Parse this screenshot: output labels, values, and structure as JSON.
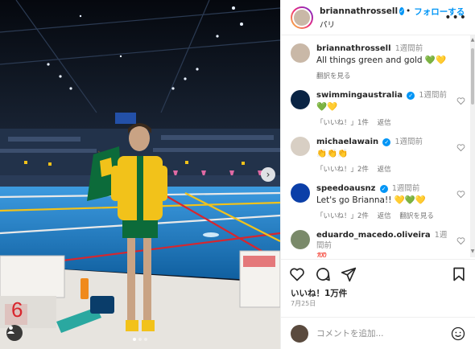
{
  "post": {
    "author": "briannathrossell",
    "follow_label": "フォローする",
    "location": "パリ",
    "more_label": "•••",
    "likes": "いいね！1万件",
    "date": "7月25日"
  },
  "caption": {
    "user": "briannathrossell",
    "time": "1週間前",
    "text": "All things green and gold 💚💛",
    "translate": "翻訳を見る"
  },
  "comments": [
    {
      "user": "swimmingaustralia",
      "verified": true,
      "time": "1週間前",
      "text": "💚💛",
      "likes": "「いいね！」1件",
      "reply": "返信",
      "translate": "",
      "avatar_color": "#0a2444"
    },
    {
      "user": "michaelawain",
      "verified": true,
      "time": "1週間前",
      "text": "👏👏👏",
      "likes": "「いいね！」2件",
      "reply": "返信",
      "translate": "",
      "avatar_color": "#d8cfc4"
    },
    {
      "user": "speedoausnz",
      "verified": true,
      "time": "1週間前",
      "text": "Let's go Brianna!! 💛💚💛",
      "likes": "「いいね！」2件",
      "reply": "返信",
      "translate": "翻訳を見る",
      "avatar_color": "#0b3fa8"
    },
    {
      "user": "eduardo_macedo.oliveira",
      "verified": false,
      "time": "1週間前",
      "text": "💯",
      "likes": "",
      "reply": "",
      "translate": "",
      "avatar_color": "#7a8a6a"
    }
  ],
  "add_comment": {
    "placeholder": "コメントを追加..."
  },
  "photo": {
    "lane_number": "6"
  },
  "icons": {
    "like": "heart-icon",
    "comment": "comment-icon",
    "share": "share-icon",
    "save": "bookmark-icon",
    "emoji": "emoji-icon",
    "next": "chevron-right-icon",
    "tag": "user-tag-icon"
  },
  "colors": {
    "accent": "#0095f6",
    "pool": "#1c7fc4",
    "lane_red": "#d8262d",
    "cap_yellow": "#f2c21a",
    "green": "#0c6b3a"
  }
}
